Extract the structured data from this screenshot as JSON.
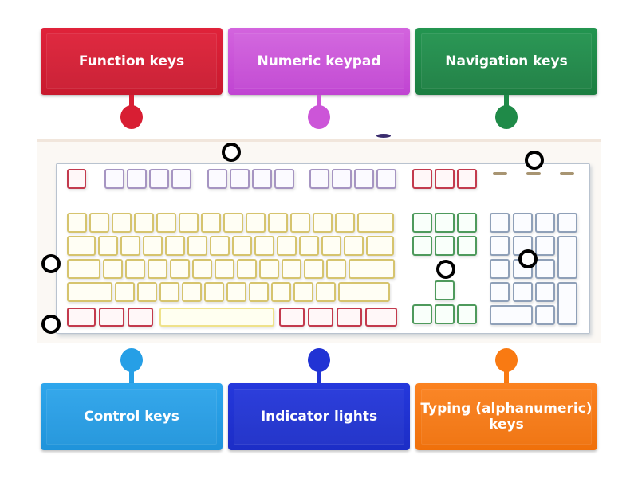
{
  "labels": {
    "top": [
      {
        "text": "Function keys",
        "color": "#d81e33",
        "pin_color": "#d81e33"
      },
      {
        "text": "Numeric keypad",
        "color": "#cc55d8",
        "pin_color": "#cc55d8"
      },
      {
        "text": "Navigation keys",
        "color": "#1f8a48",
        "pin_color": "#1f8a48"
      }
    ],
    "bottom": [
      {
        "text": "Control keys",
        "color": "#269fe6",
        "pin_color": "#269fe6"
      },
      {
        "text": "Indicator lights",
        "color": "#2133d4",
        "pin_color": "#2133d4"
      },
      {
        "text": "Typing (alphanumeric) keys",
        "color": "#f97a12",
        "pin_color": "#f97a12"
      }
    ]
  },
  "diagram": {
    "subject": "keyboard",
    "hotspot_count": 7,
    "key_group_colors": {
      "typing": "#d6c46e",
      "function": "#a695c2",
      "control": "#c33a4d",
      "navigation": "#4e9a5c",
      "numeric": "#8fa0b8",
      "indicator_lights": "#a89572"
    }
  }
}
